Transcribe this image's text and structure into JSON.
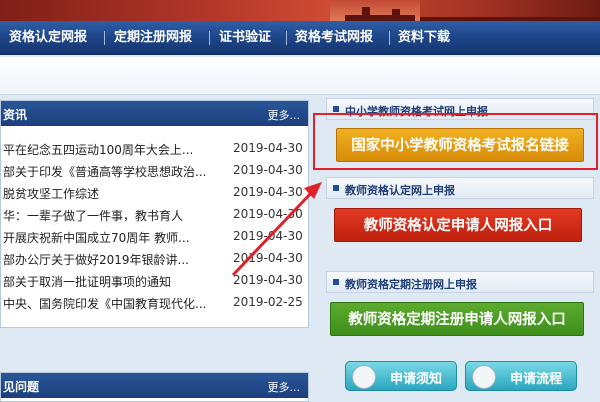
{
  "nav": {
    "items": [
      {
        "label": "资格认定网报"
      },
      {
        "label": "定期注册网报"
      },
      {
        "label": "证书验证"
      },
      {
        "label": "资格考试网报"
      },
      {
        "label": "资料下载"
      }
    ]
  },
  "news_panel": {
    "title": "资讯",
    "more": "更多...",
    "items": [
      {
        "title": "平在纪念五四运动100周年大会上...",
        "date": "2019-04-30"
      },
      {
        "title": "部关于印发《普通高等学校思想政治...",
        "date": "2019-04-30"
      },
      {
        "title": "脱贫攻坚工作综述",
        "date": "2019-04-30"
      },
      {
        "title": "华：一辈子做了一件事，教书育人",
        "date": "2019-04-30"
      },
      {
        "title": "开展庆祝新中国成立70周年 教师...",
        "date": "2019-04-30"
      },
      {
        "title": "部办公厅关于做好2019年银龄讲...",
        "date": "2019-04-30"
      },
      {
        "title": "部关于取消一批证明事项的通知",
        "date": "2019-04-30"
      },
      {
        "title": "中央、国务院印发《中国教育现代化...",
        "date": "2019-02-25"
      }
    ]
  },
  "faq_panel": {
    "title": "见问题",
    "more": "更多..."
  },
  "right": {
    "sec1": {
      "label": "中小学教师资格考试网上申报",
      "button": "国家中小学教师资格考试报名链接"
    },
    "sec2": {
      "label": "教师资格认定网上申报",
      "button": "教师资格认定申请人网报入口"
    },
    "sec3": {
      "label": "教师资格定期注册网上申报",
      "button": "教师资格定期注册申请人网报入口"
    },
    "pills": [
      {
        "label": "申请须知",
        "icon": "megaphone-icon"
      },
      {
        "label": "申请流程",
        "icon": "gears-icon"
      }
    ]
  },
  "colors": {
    "nav": "#1d4487",
    "highlight": "#e0212a",
    "gold": "#e09a10",
    "red": "#cf2a16",
    "green": "#4a9a24"
  }
}
